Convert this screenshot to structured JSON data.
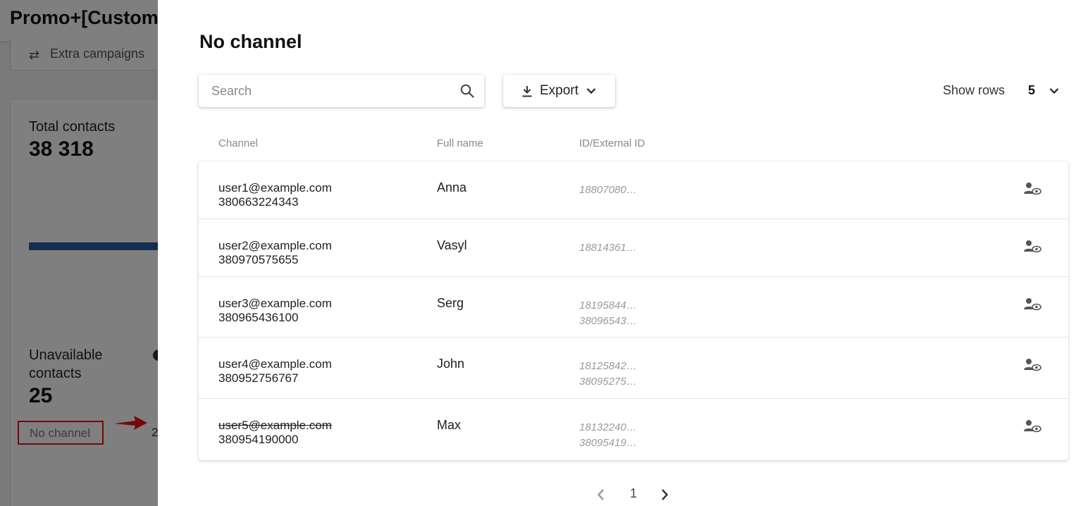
{
  "background": {
    "app_title": "Promo+[Custome",
    "extra_campaigns_label": "Extra campaigns",
    "total_contacts_label": "Total contacts",
    "total_contacts_value": "38 318",
    "unavailable_label": "Unavailable contacts",
    "unavailable_value": "25",
    "no_channel_label": "No channel",
    "no_channel_count": "2",
    "accent_color": "#2a58a5",
    "highlight_color": "#ee1111"
  },
  "drawer": {
    "title": "No channel",
    "search": {
      "placeholder": "Search",
      "value": "",
      "icon": "search-icon"
    },
    "export": {
      "label": "Export",
      "icon": "download-icon"
    },
    "show_rows": {
      "label": "Show rows",
      "value": "5"
    },
    "columns": [
      "Channel",
      "Full name",
      "ID/External ID"
    ],
    "rows": [
      {
        "email": "user1@example.com",
        "phone": "380663224343",
        "name": "Anna",
        "ids": [
          "18807080…"
        ],
        "email_struck": false
      },
      {
        "email": "user2@example.com",
        "phone": "380970575655",
        "name": "Vasyl",
        "ids": [
          "18814361…"
        ],
        "email_struck": false
      },
      {
        "email": "user3@example.com",
        "phone": "380965436100",
        "name": "Serg",
        "ids": [
          "18195844…",
          "38096543…"
        ],
        "email_struck": false
      },
      {
        "email": "user4@example.com",
        "phone": "380952756767",
        "name": "John",
        "ids": [
          "18125842…",
          "38095275…"
        ],
        "email_struck": false
      },
      {
        "email": "user5@example.com",
        "phone": "380954190000",
        "name": "Max",
        "ids": [
          "18132240…",
          "38095419…"
        ],
        "email_struck": true
      }
    ],
    "pagination": {
      "current_page": "1"
    }
  }
}
